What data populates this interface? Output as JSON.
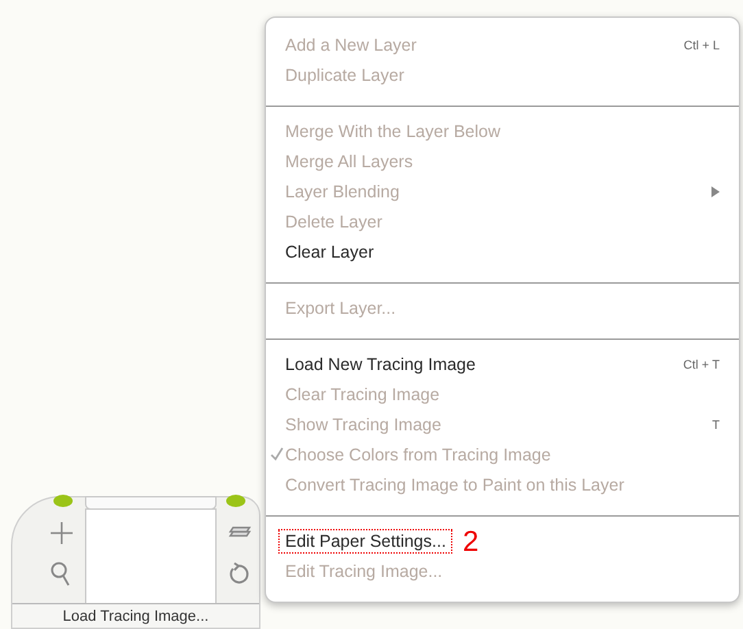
{
  "menu": {
    "sections": [
      {
        "items": [
          {
            "label": "Add a New Layer",
            "shortcut": "Ctl + L",
            "disabled": true,
            "checked": false,
            "submenu": false,
            "highlighted": false
          },
          {
            "label": "Duplicate Layer",
            "disabled": true,
            "checked": false,
            "submenu": false,
            "highlighted": false
          }
        ]
      },
      {
        "items": [
          {
            "label": "Merge With the Layer Below",
            "disabled": true,
            "checked": false,
            "submenu": false,
            "highlighted": false
          },
          {
            "label": "Merge All Layers",
            "disabled": true,
            "checked": false,
            "submenu": false,
            "highlighted": false
          },
          {
            "label": "Layer Blending",
            "disabled": true,
            "checked": false,
            "submenu": true,
            "highlighted": false
          },
          {
            "label": "Delete Layer",
            "disabled": true,
            "checked": false,
            "submenu": false,
            "highlighted": false
          },
          {
            "label": "Clear Layer",
            "disabled": false,
            "checked": false,
            "submenu": false,
            "highlighted": false
          }
        ]
      },
      {
        "items": [
          {
            "label": "Export Layer...",
            "disabled": true,
            "checked": false,
            "submenu": false,
            "highlighted": false
          }
        ]
      },
      {
        "items": [
          {
            "label": "Load New Tracing Image",
            "shortcut": "Ctl + T",
            "disabled": false,
            "checked": false,
            "submenu": false,
            "highlighted": false
          },
          {
            "label": "Clear Tracing Image",
            "disabled": true,
            "checked": false,
            "submenu": false,
            "highlighted": false
          },
          {
            "label": "Show Tracing Image",
            "shortcut": "T",
            "disabled": true,
            "checked": false,
            "submenu": false,
            "highlighted": false
          },
          {
            "label": "Choose Colors from Tracing Image",
            "disabled": true,
            "checked": true,
            "submenu": false,
            "highlighted": false
          },
          {
            "label": "Convert Tracing Image to Paint on this Layer",
            "disabled": true,
            "checked": false,
            "submenu": false,
            "highlighted": false
          }
        ]
      },
      {
        "items": [
          {
            "label": "Edit Paper Settings...",
            "disabled": false,
            "checked": false,
            "submenu": false,
            "highlighted": true,
            "callout": "2"
          },
          {
            "label": "Edit Tracing Image...",
            "disabled": true,
            "checked": false,
            "submenu": false,
            "highlighted": false
          }
        ]
      }
    ]
  },
  "navigator": {
    "button": "Load Tracing Image..."
  }
}
